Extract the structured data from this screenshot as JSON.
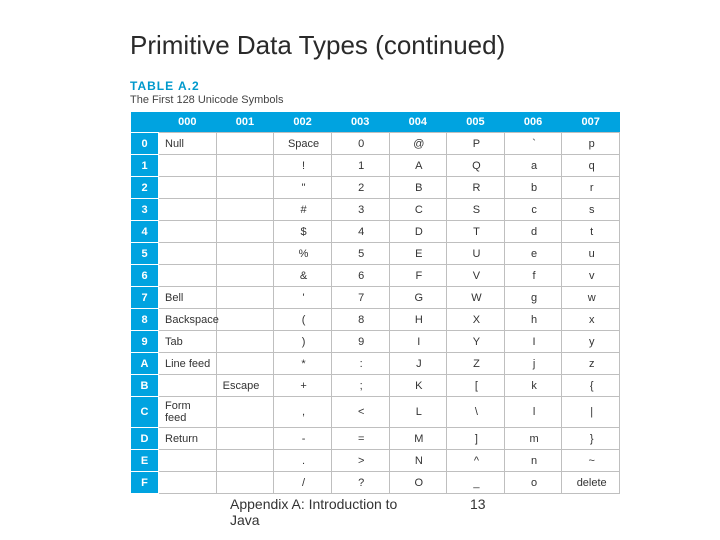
{
  "title": "Primitive Data Types (continued)",
  "table_label": "TABLE A.2",
  "table_caption": "The First 128 Unicode Symbols",
  "headers": [
    "",
    "000",
    "001",
    "002",
    "003",
    "004",
    "005",
    "006",
    "007"
  ],
  "row_labels": [
    "0",
    "1",
    "2",
    "3",
    "4",
    "5",
    "6",
    "7",
    "8",
    "9",
    "A",
    "B",
    "C",
    "D",
    "E",
    "F"
  ],
  "cells": {
    "r0": [
      "Null",
      "",
      "Space",
      "0",
      "@",
      "P",
      "`",
      "p"
    ],
    "r1": [
      "",
      "",
      "!",
      "1",
      "A",
      "Q",
      "a",
      "q"
    ],
    "r2": [
      "",
      "",
      "\"",
      "2",
      "B",
      "R",
      "b",
      "r"
    ],
    "r3": [
      "",
      "",
      "#",
      "3",
      "C",
      "S",
      "c",
      "s"
    ],
    "r4": [
      "",
      "",
      "$",
      "4",
      "D",
      "T",
      "d",
      "t"
    ],
    "r5": [
      "",
      "",
      "%",
      "5",
      "E",
      "U",
      "e",
      "u"
    ],
    "r6": [
      "",
      "",
      "&",
      "6",
      "F",
      "V",
      "f",
      "v"
    ],
    "r7": [
      "Bell",
      "",
      "'",
      "7",
      "G",
      "W",
      "g",
      "w"
    ],
    "r8": [
      "Backspace",
      "",
      "(",
      "8",
      "H",
      "X",
      "h",
      "x"
    ],
    "r9": [
      "Tab",
      "",
      ")",
      "9",
      "I",
      "Y",
      "I",
      "y"
    ],
    "rA": [
      "Line feed",
      "",
      "*",
      ":",
      "J",
      "Z",
      "j",
      "z"
    ],
    "rB": [
      "",
      "Escape",
      "+",
      ";",
      "K",
      "[",
      "k",
      "{"
    ],
    "rC": [
      "Form feed",
      "",
      ",",
      "<",
      "L",
      "\\",
      "l",
      "|"
    ],
    "rD": [
      "Return",
      "",
      "-",
      "=",
      "M",
      "]",
      "m",
      "}"
    ],
    "rE": [
      "",
      "",
      ".",
      ">",
      "N",
      "^",
      "n",
      "~"
    ],
    "rF": [
      "",
      "",
      "/",
      "?",
      "O",
      "_",
      "o",
      "delete"
    ]
  },
  "footer_text": "Appendix A: Introduction to Java",
  "footer_page": "13"
}
